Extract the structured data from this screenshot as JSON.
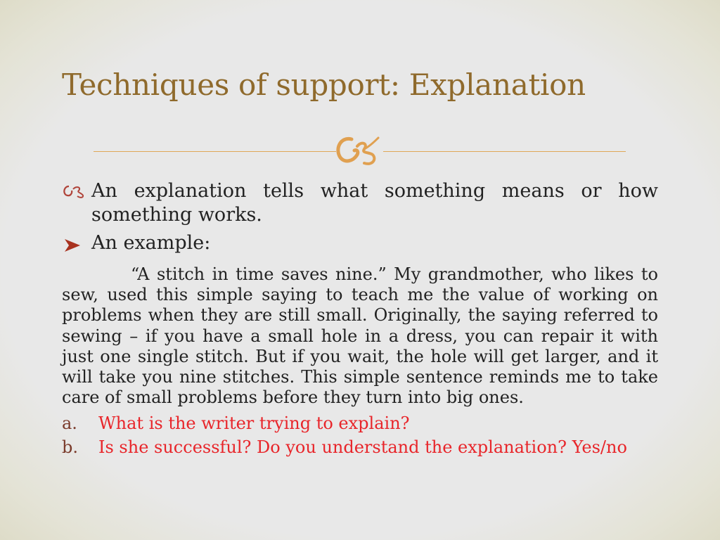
{
  "slide": {
    "title": "Techniques of support: Explanation",
    "divider_icon": "ornament-flourish-icon",
    "bullets": [
      {
        "icon": "flourish-bullet-icon",
        "text": "An explanation tells what something means or how something works."
      },
      {
        "icon": "arrow-bullet-icon",
        "text": "An example:"
      }
    ],
    "example_paragraph": "“A stitch in time saves nine.” My grandmother, who likes to sew, used this simple saying to teach me the value of working on problems when they are still small. Originally, the saying referred to sewing – if you have a small hole in a dress, you can repair it with just one single stitch. But if you wait, the hole will get larger, and it will take you nine stitches. This simple sentence reminds me to take care of small problems before they turn into big ones.",
    "questions": [
      {
        "label": "a.",
        "text": "What is the writer trying to explain?"
      },
      {
        "label": "b.",
        "text": "Is she successful? Do you understand the explanation? Yes/no"
      }
    ],
    "colors": {
      "title": "#8f6a2c",
      "accent": "#e0a858",
      "question": "#e8252a",
      "bullet": "#b0443a"
    }
  }
}
